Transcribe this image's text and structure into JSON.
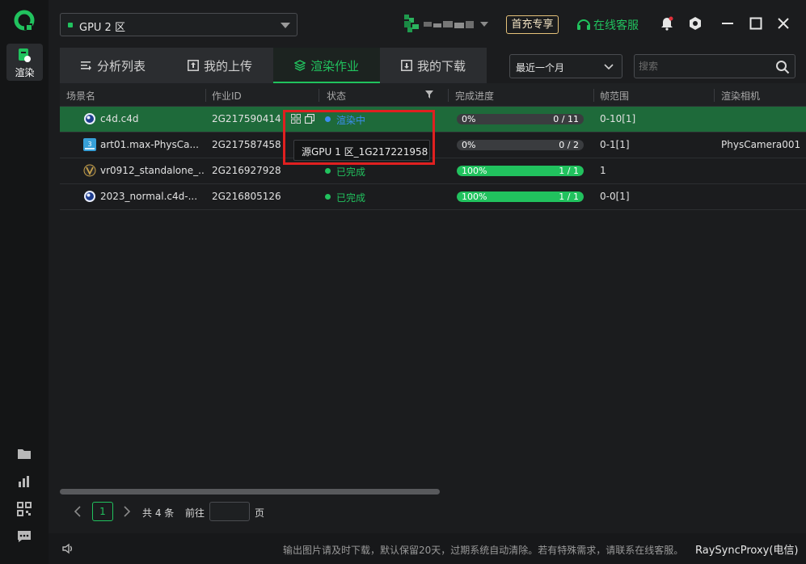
{
  "sidebar": {
    "logo_icon": "ray-logo-icon",
    "render_label": "渲染",
    "bottom_icons": [
      "folder-icon",
      "bar-chart-icon",
      "qr-code-icon",
      "chat-icon"
    ]
  },
  "topbar": {
    "region": "GPU 2 区",
    "vip_label": "首充专享",
    "service_label": "在线客服",
    "accent_color": "#21c25e"
  },
  "tabs": [
    {
      "label": "分析列表",
      "icon": "list-icon"
    },
    {
      "label": "我的上传",
      "icon": "upload-icon"
    },
    {
      "label": "渲染作业",
      "icon": "layers-icon",
      "active": true
    },
    {
      "label": "我的下载",
      "icon": "download-icon"
    }
  ],
  "filters": {
    "period": "最近一个月",
    "search_placeholder": "搜索"
  },
  "table": {
    "columns": [
      "场景名",
      "作业ID",
      "状态",
      "完成进度",
      "帧范围",
      "渲染相机"
    ],
    "rows": [
      {
        "name": "c4d.c4d",
        "app": "cinema4d",
        "id": "2G217590414",
        "status": "渲染中",
        "status_color": "#3b8ef0",
        "progress_pct": "0%",
        "progress_value": 0,
        "count": "0 / 11",
        "frames": "0-10[1]",
        "camera": ""
      },
      {
        "name": "art01.max-PhysCa...",
        "app": "3dsmax",
        "id": "2G217587458",
        "status": "",
        "status_color": "#21c25e",
        "progress_pct": "0%",
        "progress_value": 0,
        "count": "0 / 2",
        "frames": "0-1[1]",
        "camera": "PhysCamera001"
      },
      {
        "name": "vr0912_standalone_...",
        "app": "vray",
        "id": "2G216927928",
        "status": "已完成",
        "status_color": "#21c25e",
        "progress_pct": "100%",
        "progress_value": 100,
        "count": "1 / 1",
        "frames": "1",
        "camera": ""
      },
      {
        "name": "2023_normal.c4d-...",
        "app": "cinema4d",
        "id": "2G216805126",
        "status": "已完成",
        "status_color": "#21c25e",
        "progress_pct": "100%",
        "progress_value": 100,
        "count": "1 / 1",
        "frames": "0-0[1]",
        "camera": ""
      }
    ]
  },
  "tooltip": "源GPU 1 区_1G217221958",
  "pager": {
    "current": "1",
    "total": "共 4 条",
    "goto": "前往",
    "page_unit": "页"
  },
  "footer": {
    "notice": "输出图片请及时下载，默认保留20天，过期系统自动清除。若有特殊需求，请联系在线客服。",
    "proxy": "RaySyncProxy(电信)"
  }
}
